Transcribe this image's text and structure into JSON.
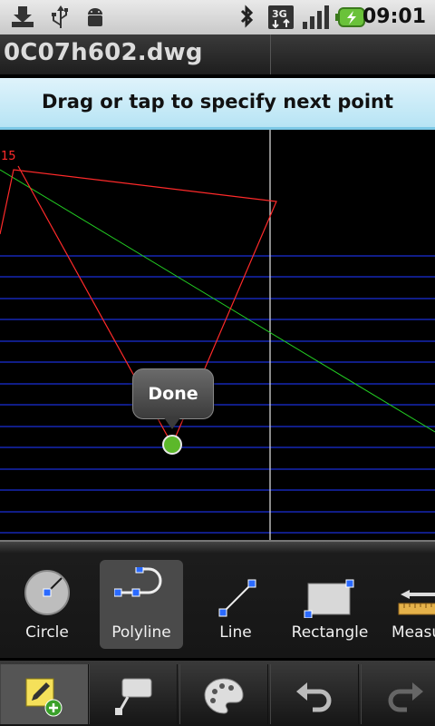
{
  "status_bar": {
    "time": "09:01"
  },
  "title_bar": {
    "filename": "0C07h602.dwg"
  },
  "prompt": "Drag or tap to specify next point",
  "canvas": {
    "vertex_label": "15",
    "done_label": "Done"
  },
  "tools": [
    {
      "id": "circle",
      "label": "Circle"
    },
    {
      "id": "polyline",
      "label": "Polyline",
      "selected": true
    },
    {
      "id": "line",
      "label": "Line"
    },
    {
      "id": "rectangle",
      "label": "Rectangle"
    },
    {
      "id": "measure",
      "label": "Measure"
    }
  ],
  "bottom_bar": [
    "draw-add-icon",
    "annotate-icon",
    "palette-icon",
    "undo-icon",
    "redo-icon"
  ],
  "colors": {
    "polyline": "#ff2a2a",
    "guide": "#22cc22",
    "gridline": "#1a2fd8",
    "selection": "#2a6aff"
  }
}
